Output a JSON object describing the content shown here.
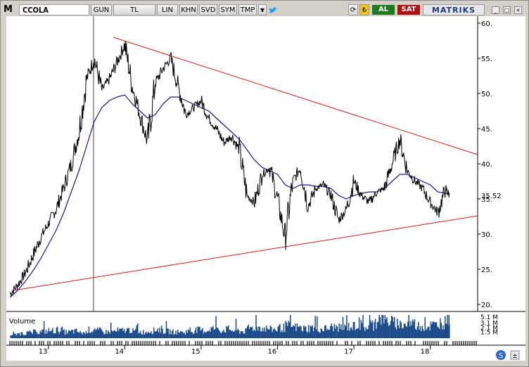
{
  "toolbar": {
    "menu_letter": "M",
    "symbol": "CCOLA",
    "buttons": [
      "GUN",
      "TL",
      "LIN",
      "KHN",
      "SVD",
      "SYM",
      "TMP"
    ],
    "buy_label": "AL",
    "sell_label": "SAT",
    "brand": "MATRIKS",
    "colors": {
      "buy": "#1f7a1f",
      "sell": "#b01010",
      "brand": "#1a3a8a"
    }
  },
  "chart_data": {
    "type": "line",
    "symbol": "CCOLA",
    "title": "",
    "ylim": [
      19,
      61
    ],
    "y_ticks": [
      "60.",
      "55.",
      "50.",
      "45.",
      "40.",
      "35.",
      "30.",
      "25.",
      "20."
    ],
    "x_ticks": [
      "13",
      "14",
      "15",
      "16",
      "17",
      "18"
    ],
    "last_value_label": "35.52",
    "x": [
      2012.5,
      2012.6,
      2012.7,
      2012.8,
      2012.9,
      2013.0,
      2013.1,
      2013.2,
      2013.3,
      2013.4,
      2013.5,
      2013.6,
      2013.7,
      2013.8,
      2013.9,
      2014.0,
      2014.1,
      2014.2,
      2014.3,
      2014.4,
      2014.5,
      2014.6,
      2014.7,
      2014.8,
      2014.9,
      2015.0,
      2015.1,
      2015.2,
      2015.3,
      2015.4,
      2015.5,
      2015.6,
      2015.7,
      2015.8,
      2015.9,
      2016.0,
      2016.1,
      2016.2,
      2016.3,
      2016.4,
      2016.5,
      2016.6,
      2016.7,
      2016.8,
      2016.9,
      2017.0,
      2017.1,
      2017.2,
      2017.3,
      2017.4,
      2017.5,
      2017.6,
      2017.7,
      2017.8,
      2017.9,
      2018.0,
      2018.1,
      2018.2,
      2018.25
    ],
    "series": [
      {
        "values": [
          21.5,
          22.8,
          24.5,
          27.0,
          29.5,
          31.5,
          33.5,
          36.5,
          40.0,
          44.5,
          52.0,
          55.0,
          50.5,
          52.0,
          54.5,
          57.0,
          51.0,
          47.0,
          43.0,
          51.5,
          53.5,
          55.0,
          51.0,
          47.0,
          48.0,
          49.0,
          46.5,
          45.0,
          43.0,
          44.0,
          42.0,
          35.5,
          34.5,
          38.5,
          39.5,
          35.0,
          29.5,
          37.5,
          39.5,
          34.0,
          36.5,
          37.0,
          35.5,
          32.0,
          33.5,
          37.5,
          35.5,
          34.5,
          36.0,
          36.5,
          40.0,
          43.5,
          39.0,
          37.5,
          36.5,
          34.5,
          33.0,
          36.5,
          35.52
        ]
      },
      {
        "values": [
          21.0,
          22.0,
          23.3,
          24.8,
          26.5,
          28.5,
          30.5,
          33.0,
          36.0,
          39.0,
          42.5,
          46.0,
          48.0,
          49.0,
          49.5,
          49.8,
          48.5,
          47.5,
          46.5,
          47.0,
          48.5,
          49.5,
          49.5,
          49.0,
          48.5,
          48.0,
          47.5,
          46.5,
          45.5,
          44.5,
          43.5,
          42.0,
          40.5,
          39.5,
          39.0,
          38.5,
          37.0,
          36.5,
          37.0,
          37.0,
          36.8,
          36.8,
          36.5,
          35.5,
          35.0,
          35.5,
          35.8,
          36.0,
          36.0,
          36.5,
          37.5,
          38.5,
          38.5,
          38.0,
          37.5,
          37.0,
          36.0,
          35.8,
          35.7
        ]
      }
    ],
    "trendlines": [
      {
        "x": [
          2013.85,
          2018.62
        ],
        "y": [
          58.0,
          41.3
        ]
      },
      {
        "x": [
          2012.55,
          2018.62
        ],
        "y": [
          22.0,
          32.6
        ]
      }
    ],
    "volume": {
      "label": "Volume",
      "tick_labels": [
        "5.1 M",
        "3.1 M",
        "2.1 M",
        "1.5 M"
      ],
      "values": [
        0.5,
        0.7,
        0.8,
        0.9,
        1.0,
        1.1,
        1.2,
        0.9,
        1.0,
        0.8,
        1.2,
        1.1,
        0.9,
        1.0,
        1.1,
        1.2,
        1.0,
        0.9,
        1.1,
        1.3,
        1.0,
        0.9,
        0.8,
        1.0,
        1.2,
        1.1,
        1.4,
        1.2,
        1.3,
        1.1,
        1.0,
        1.5,
        1.6,
        1.4,
        1.3,
        1.5,
        1.8,
        1.6,
        1.4,
        1.5,
        1.3,
        1.4,
        1.6,
        1.5,
        1.7,
        1.9,
        1.6,
        2.0,
        3.2,
        2.5,
        2.2,
        2.0,
        2.1,
        1.8,
        1.7,
        1.9,
        2.3,
        2.8,
        2.0
      ]
    }
  }
}
